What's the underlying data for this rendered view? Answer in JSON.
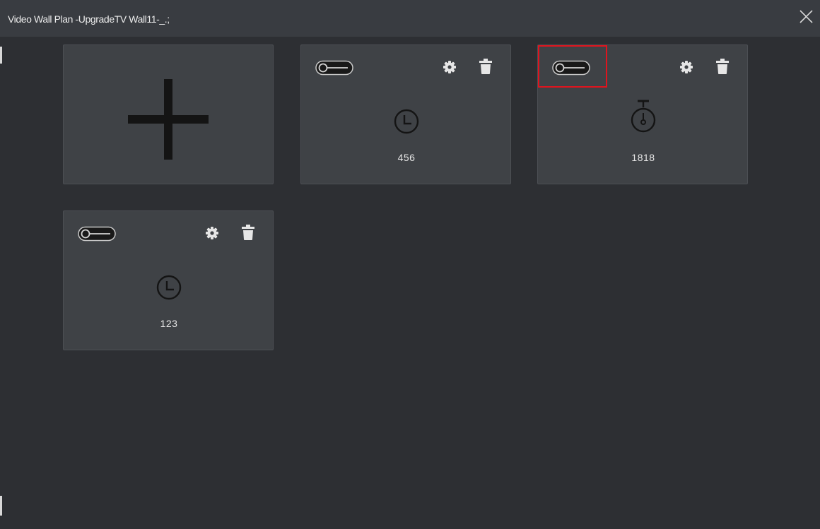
{
  "window": {
    "title": "Video Wall Plan -UpgradeTV Wall11-_.;"
  },
  "add_card": {
    "icon": "plus-icon"
  },
  "plans": [
    {
      "label": "456",
      "icon": "clock-icon",
      "toggle_on": false
    },
    {
      "label": "1818",
      "icon": "stopwatch-icon",
      "toggle_on": false,
      "highlighted": true
    },
    {
      "label": "123",
      "icon": "clock-icon",
      "toggle_on": false
    }
  ],
  "colors": {
    "background": "#2d2f33",
    "titlebar": "#393c41",
    "card": "#3f4246",
    "highlight": "#e0141e",
    "icon": "#141414",
    "action_icon": "#e6e6e6"
  }
}
